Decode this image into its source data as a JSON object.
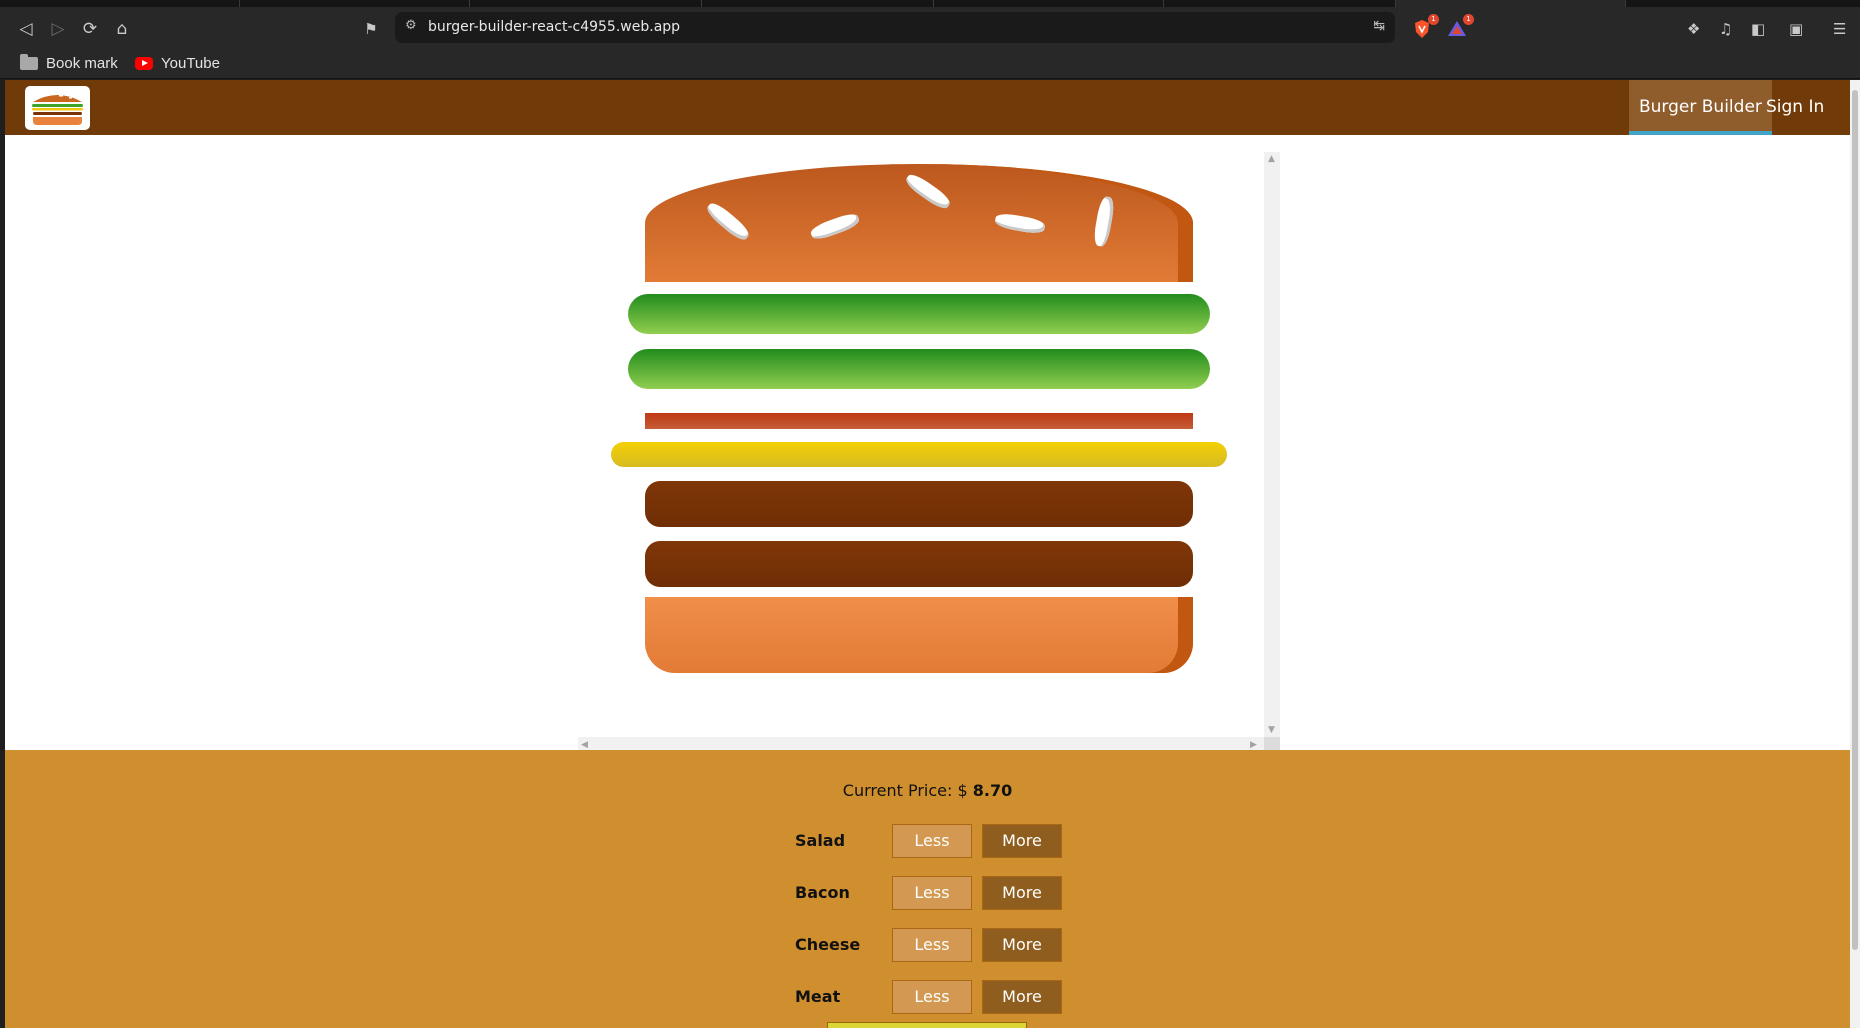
{
  "browser": {
    "url": "burger-builder-react-c4955.web.app",
    "bookmarks": [
      {
        "label": "Book mark",
        "icon": "folder-icon"
      },
      {
        "label": "YouTube",
        "icon": "youtube-icon"
      }
    ],
    "extension_badges": [
      "1",
      "1"
    ]
  },
  "app": {
    "nav": {
      "burger_builder": "Burger Builder",
      "sign_in": "Sign In"
    },
    "price_label": "Current Price: $ ",
    "price_value": "8.70",
    "controls": [
      {
        "label": "Salad",
        "less": "Less",
        "more": "More"
      },
      {
        "label": "Bacon",
        "less": "Less",
        "more": "More"
      },
      {
        "label": "Cheese",
        "less": "Less",
        "more": "More"
      },
      {
        "label": "Meat",
        "less": "Less",
        "more": "More"
      }
    ],
    "ingredients": [
      "bread-top",
      "salad",
      "salad",
      "bacon",
      "cheese",
      "meat",
      "meat",
      "bread-bottom"
    ]
  },
  "colors": {
    "toolbar": "#703b09",
    "build_controls": "#cf8f2e",
    "active_underline": "#40a4c8"
  }
}
